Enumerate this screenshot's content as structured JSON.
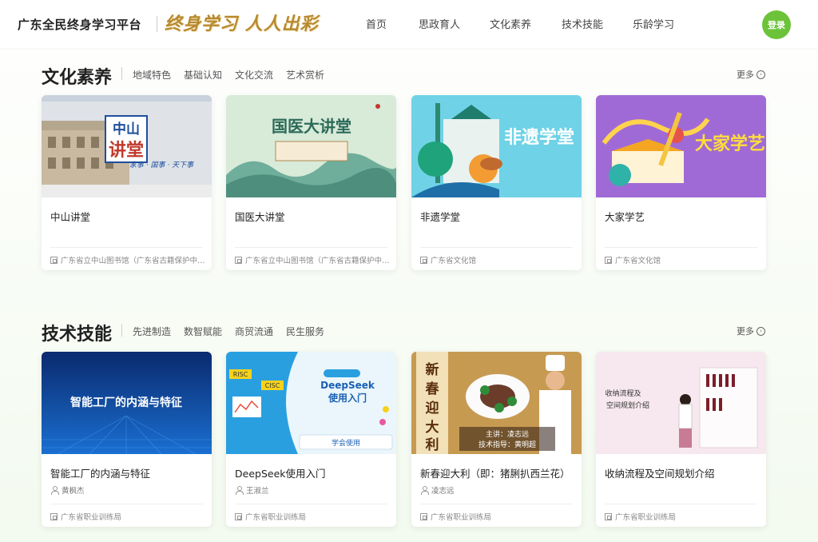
{
  "header": {
    "brand": "广东全民终身学习平台",
    "slogan": "终身学习 人人出彩",
    "nav": [
      "首页",
      "思政育人",
      "文化素养",
      "技术技能",
      "乐龄学习"
    ],
    "login_label": "登录"
  },
  "colors": {
    "accent": "#6cc33a",
    "slogan": "#b7892e"
  },
  "culture": {
    "title": "文化素养",
    "tabs": [
      "地域特色",
      "基础认知",
      "文化交流",
      "艺术赏析"
    ],
    "more": "更多",
    "cards": [
      {
        "title": "中山讲堂",
        "org": "广东省立中山图书馆（广东省古籍保护中…",
        "image": {
          "caption": "中山讲堂",
          "sub": "家事 · 国事 · 天下事"
        }
      },
      {
        "title": "国医大讲堂",
        "org": "广东省立中山图书馆（广东省古籍保护中…",
        "image": {
          "caption": "国医大讲堂"
        }
      },
      {
        "title": "非遗学堂",
        "org": "广东省文化馆",
        "image": {
          "caption": "非遗学堂"
        }
      },
      {
        "title": "大家学艺",
        "org": "广东省文化馆",
        "image": {
          "caption": "大家学艺"
        }
      }
    ]
  },
  "skills": {
    "title": "技术技能",
    "tabs": [
      "先进制造",
      "数智赋能",
      "商贸流通",
      "民生服务"
    ],
    "more": "更多",
    "cards": [
      {
        "title": "智能工厂的内涵与特征",
        "person": "黄枫杰",
        "org": "广东省职业训练局",
        "image": {
          "caption": "智能工厂的内涵与特征"
        }
      },
      {
        "title": "DeepSeek使用入门",
        "person": "王淑兰",
        "org": "广东省职业训练局",
        "image": {
          "caption": "DeepSeek\n使用入门",
          "tag": "学会使用",
          "label1": "RISC",
          "label2": "CISC"
        }
      },
      {
        "title": "新春迎大利（即：猪脷扒西兰花）",
        "person": "凌志远",
        "org": "广东省职业训练局",
        "image": {
          "caption": "新春迎大利",
          "line1": "主讲：凌志远",
          "line2": "技术指导：黄明超"
        }
      },
      {
        "title": "收纳流程及空间规划介绍",
        "org": "广东省职业训练局",
        "image": {
          "caption": "收纳流程及空间规划介绍"
        }
      }
    ]
  }
}
